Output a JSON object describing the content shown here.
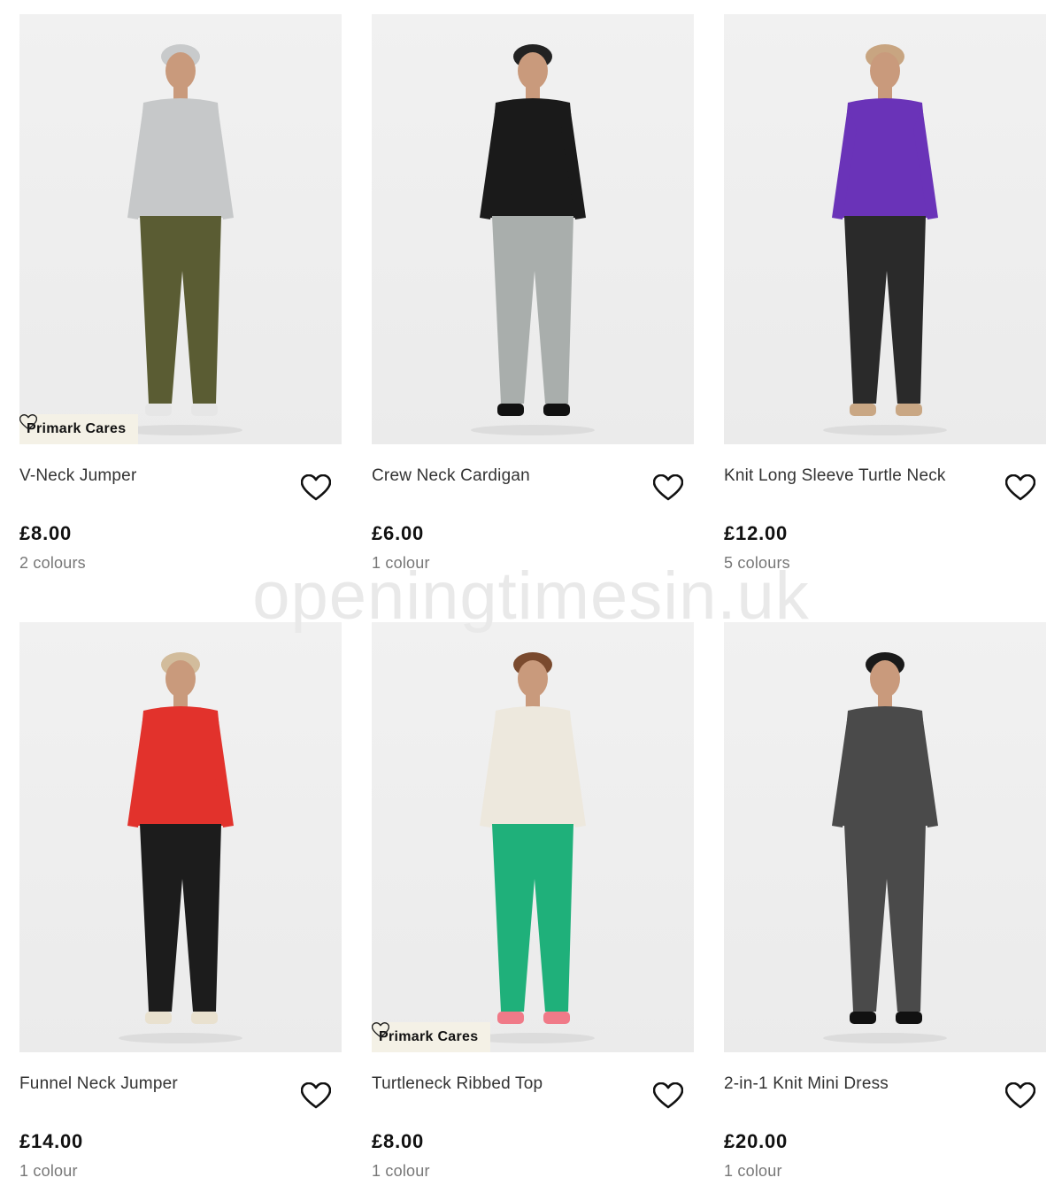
{
  "products": [
    {
      "name": "V-Neck Jumper",
      "price": "£8.00",
      "colours": "2 colours",
      "badge": "Primark Cares",
      "top_color": "#c6c8c9",
      "bottom_color": "#5a5c33",
      "hat_color": "#c8cacb",
      "shoe_color": "#e6e6e6"
    },
    {
      "name": "Crew Neck Cardigan",
      "price": "£6.00",
      "colours": "1 colour",
      "badge": "",
      "top_color": "#1a1a1a",
      "bottom_color": "#a9aeac",
      "hat_color": "#222222",
      "shoe_color": "#111111"
    },
    {
      "name": "Knit Long Sleeve Turtle Neck",
      "price": "£12.00",
      "colours": "5 colours",
      "badge": "",
      "top_color": "#6a33b8",
      "bottom_color": "#2a2a2a",
      "hat_color": "#c8a581",
      "shoe_color": "#c9a784"
    },
    {
      "name": "Funnel Neck Jumper",
      "price": "£14.00",
      "colours": "1 colour",
      "badge": "",
      "top_color": "#e2322c",
      "bottom_color": "#1c1c1c",
      "hat_color": "#d2bc9c",
      "shoe_color": "#e9e1cf"
    },
    {
      "name": "Turtleneck Ribbed Top",
      "price": "£8.00",
      "colours": "1 colour",
      "badge": "Primark Cares",
      "top_color": "#ede8dd",
      "bottom_color": "#1fb07a",
      "hat_color": "#7a4a2e",
      "shoe_color": "#f07a88"
    },
    {
      "name": "2-in-1 Knit Mini Dress",
      "price": "£20.00",
      "colours": "1 colour",
      "badge": "",
      "top_color": "#4a4a4a",
      "bottom_color": "#4a4a4a",
      "hat_color": "#1a1a1a",
      "shoe_color": "#111111"
    }
  ],
  "watermark": "openingtimesin.uk",
  "icons": {
    "favourite": "heart-outline-icon",
    "badge": "heart-outline-icon"
  }
}
